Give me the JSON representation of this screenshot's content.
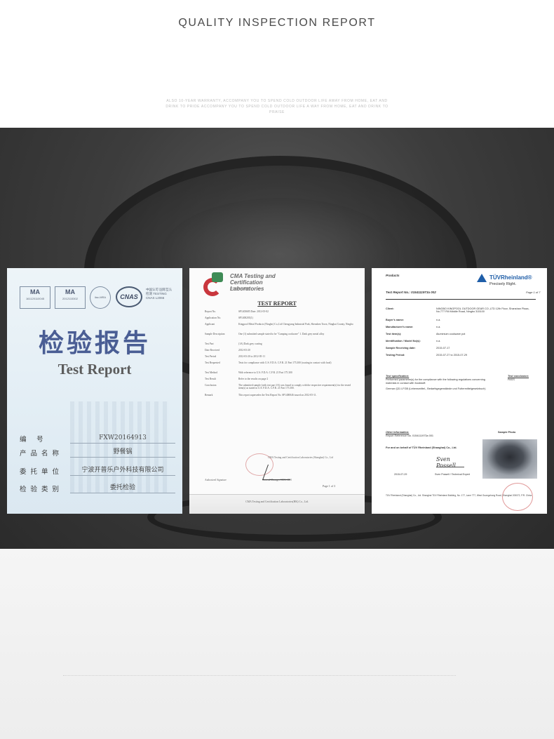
{
  "header": {
    "title": "QUALITY INSPECTION REPORT",
    "tagline": "ALSO 10-YEAR WARRANTY, ACCOMPANY YOU TO SPEND COLD OUTDOOR LIFE AWAY FROM HOME, EAT AND DRINK TO PRIDE ACCOMPANY YOU TO SPEND COLD OUTDOOR LIFE A WAY FROM HOME, EAT AND DRINK TO PRAISE"
  },
  "cards": {
    "cn_report": {
      "logo_ma1_mark": "MA",
      "logo_ma1_code": "161120110045",
      "logo_ma2_mark": "MA",
      "logo_ma2_code": "2012115302",
      "logo_ilac": "ilac-MRA",
      "logo_cnas": "CNAS",
      "logo_cnas_caption": "中国认可 国际互认 检测 TESTING CNAS L2066",
      "title_cn": "检验报告",
      "title_en": "Test Report",
      "fields": [
        {
          "label": "编 号",
          "value": "FXW20164913"
        },
        {
          "label": "产品名称",
          "value": "野餐锅"
        },
        {
          "label": "委托单位",
          "value": "宁波开普乐户外科技有限公司"
        },
        {
          "label": "检验类别",
          "value": "委托检验"
        }
      ]
    },
    "cma_report": {
      "org_name": "CMA Testing and Certification Laboratories",
      "org_sub": "华测检测认证集团",
      "heading": "TEST REPORT",
      "rows": [
        {
          "k": "Report No.",
          "v": "SP1403685      Date: 2012-05-02"
        },
        {
          "k": "Application No.",
          "v": "SP1400205(1)"
        },
        {
          "k": "Applicant",
          "v": "Kingpool Metal Products (Ningbo) Co.,Ltd Chengyang Industrial Park, Shenzhen Town, Ninghai County, Ningbo"
        },
        {
          "k": "Sample Description",
          "v": "One (1) submitted sample stated to be \"Camping cookware\" 1. Dark grey metal alloy"
        },
        {
          "k": "Test Part",
          "v": "(1A)  Dark grey coating"
        },
        {
          "k": "Date Received",
          "v": "2012-03-20"
        },
        {
          "k": "Test Period",
          "v": "2012-03-20 to 2012-05-11"
        },
        {
          "k": "Test Requested",
          "v": "Tests for compliance with U.S. F.D.A. C.F.R. 21 Part 175.300 (coating in contact with food)"
        },
        {
          "k": "Test Method",
          "v": "With reference to U.S. F.D.A. C.F.R. 21 Part 175.300"
        },
        {
          "k": "Test Result",
          "v": "Refer to the results on page 2"
        },
        {
          "k": "Conclusion",
          "v": "The submitted sample (with test part 1A) was found to comply with the respective requirement(s) for the tested item(s) as stated in U.S. F.D.A. C.F.R. 21 Part 175.300."
        },
        {
          "k": "Remark",
          "v": "This report supersedes the Test Report No. SP1400046 issued on 2012-05-11."
        }
      ],
      "signature_caption": "CMA Testing and Certification Laboratories (Shanghai) Co., Ltd",
      "signer": "General Manager  CMA SHO",
      "authorized": "Authorized Signature",
      "page": "Page 1 of 3",
      "footer": "CMA Testing and Certification Laboratories(HK) Co., Ltd."
    },
    "tuv_report": {
      "products_label": "Products",
      "brand": "TÜVRheinland®",
      "slogan": "Precisely Right.",
      "report_no": "Test Report No.:  0154111973a 002",
      "page": "Page 1 of 7",
      "rows": [
        {
          "k": "Client:",
          "v": "NINGBO KINGPOOL OUTDOOR GEAR CO.,LTD 12th Floor, Shanshan Plaza, No.777 Rili Middle Road, Ningbo 315100"
        },
        {
          "k": "Buyer's name:",
          "v": "n.a."
        },
        {
          "k": "Manufacturer's name:",
          "v": "n.a."
        },
        {
          "k": "Test item(s):",
          "v": "Aluminium cookware pot"
        },
        {
          "k": "Identification / Model No(s):",
          "v": "n.a."
        },
        {
          "k": "Sample Receiving date:",
          "v": "2015-07-17"
        },
        {
          "k": "Testing Period:",
          "v": "2015-07-27 to 2015-07-29"
        }
      ],
      "spec_heading": "Test specification:",
      "spec_text": "Performed parameter(s) for the compliance with the following regulations concerning materials in contact with foodstuff:",
      "spec_item": "German §31 LFGB (Lebensmittel-, Bedarfsgegenstände und Futtermittelgesetzbuch)",
      "conclusion_heading": "Test conclusion:",
      "conclusion": "PASS",
      "other_heading": "Other Information:",
      "other_text": "Report Reference No. 0154111973a 001",
      "photo_label": "Sample Photo",
      "behalf": "For and on behalf of TÜV Rheinland (Shanghai) Co., Ltd.",
      "signature": "Sven Possell",
      "sign_date": "2015-07-29",
      "sign_name": "Sven Possell / Technical Expert",
      "footer": "TÜV Rheinland (Shanghai) Co., Ltd. Shanghai TÜV Rheinland Building, No. 177, Lane 777, West Guangzhong Road, Shanghai 200072, P.R. China"
    }
  }
}
